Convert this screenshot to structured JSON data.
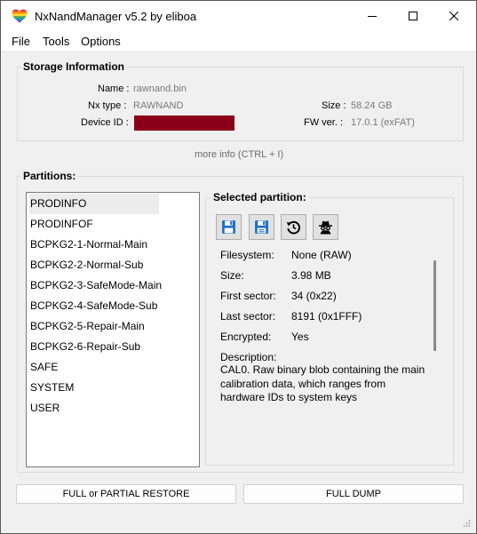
{
  "window": {
    "title": "NxNandManager v5.2 by eliboa"
  },
  "menu": {
    "file": "File",
    "tools": "Tools",
    "options": "Options"
  },
  "storage": {
    "title": "Storage Information",
    "name_label": "Name :",
    "name_value": "rawnand.bin",
    "nx_type_label": "Nx type :",
    "nx_type_value": "RAWNAND",
    "device_id_label": "Device ID :",
    "size_label": "Size :",
    "size_value": "58.24 GB",
    "fw_label": "FW ver. :",
    "fw_value": "17.0.1 (exFAT)",
    "more_info": "more info (CTRL + I)",
    "redaction_color": "#8b0018"
  },
  "partitions": {
    "title": "Partitions:",
    "items": [
      "PRODINFO",
      "PRODINFOF",
      "BCPKG2-1-Normal-Main",
      "BCPKG2-2-Normal-Sub",
      "BCPKG2-3-SafeMode-Main",
      "BCPKG2-4-SafeMode-Sub",
      "BCPKG2-5-Repair-Main",
      "BCPKG2-6-Repair-Sub",
      "SAFE",
      "SYSTEM",
      "USER"
    ],
    "selected": "PRODINFO"
  },
  "selected_partition": {
    "title": "Selected partition:",
    "tools": [
      "save-icon",
      "save-as-icon",
      "restore-icon",
      "spy-icon"
    ],
    "filesystem_label": "Filesystem:",
    "filesystem_value": "None (RAW)",
    "size_label": "Size:",
    "size_value": "3.98 MB",
    "first_sector_label": "First sector:",
    "first_sector_value": "34 (0x22)",
    "last_sector_label": "Last sector:",
    "last_sector_value": "8191 (0x1FFF)",
    "encrypted_label": "Encrypted:",
    "encrypted_value": "Yes",
    "description_label": "Description:",
    "description_value": "CAL0. Raw binary blob containing the main calibration data, which ranges from hardware IDs to system keys"
  },
  "buttons": {
    "restore": "FULL or PARTIAL RESTORE",
    "dump": "FULL DUMP"
  }
}
